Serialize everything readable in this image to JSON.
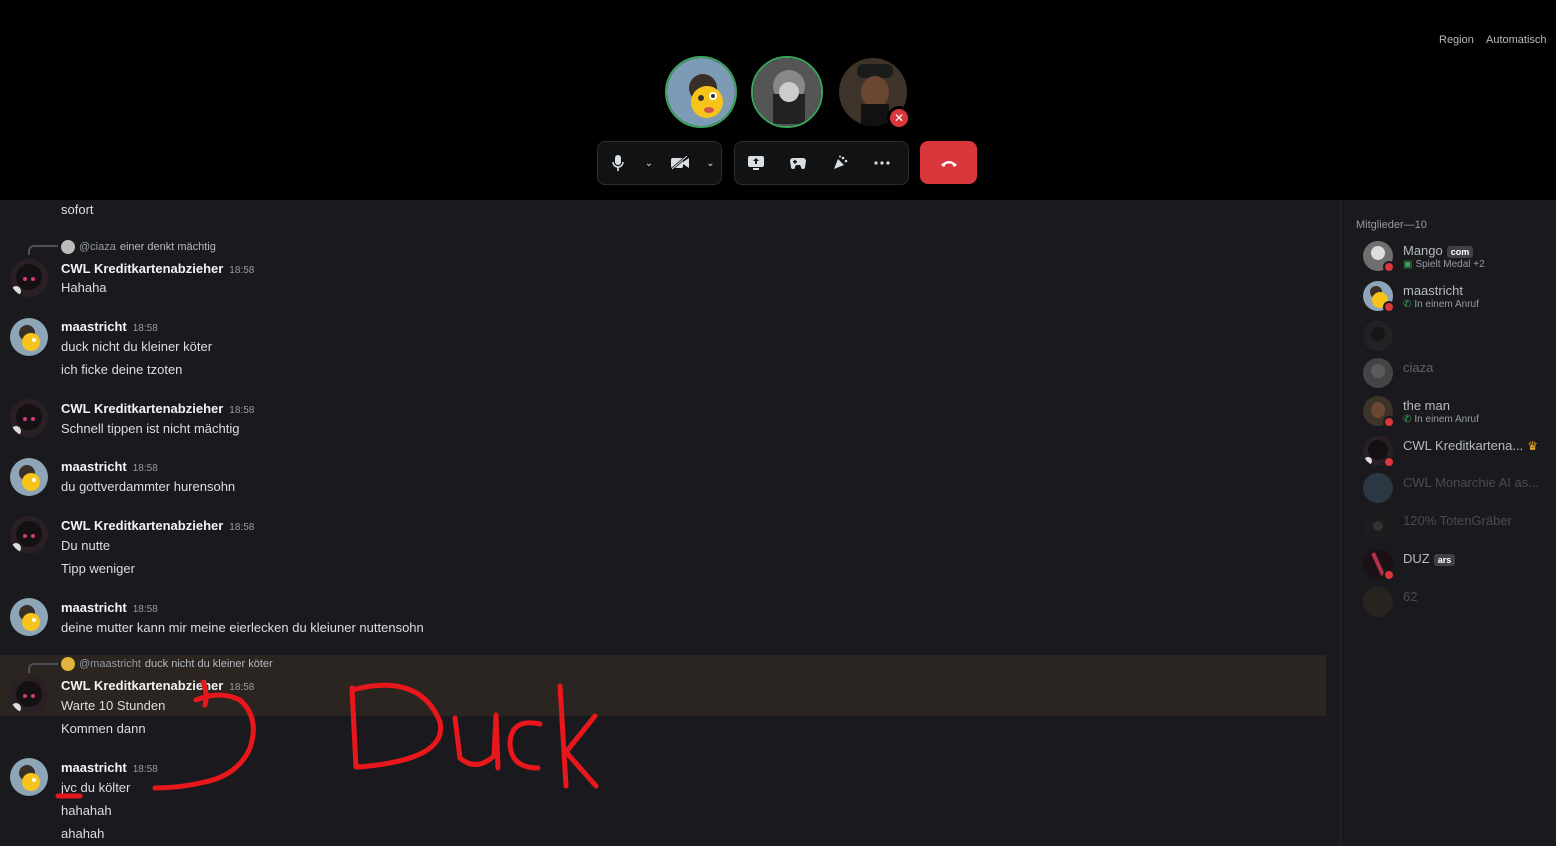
{
  "region": {
    "label": "Region",
    "value": "Automatisch"
  },
  "call": {
    "participants": [
      {
        "name": "maastricht",
        "speaking": true
      },
      {
        "name": "ciaza",
        "speaking": true
      },
      {
        "name": "the man",
        "speaking": false,
        "muted": true
      }
    ],
    "controls": [
      "mic-icon",
      "chevron-down-icon",
      "camera-off-icon",
      "chevron-down-icon",
      "screen-share-icon",
      "activity-icon",
      "soundboard-icon",
      "more-icon",
      "hang-up-icon"
    ]
  },
  "messages": [
    {
      "type": "continuation",
      "text": "sofort"
    },
    {
      "type": "reply",
      "reply_to": "@ciaza",
      "reply_text": "einer denkt mächtig",
      "author": "CWL Kreditkartenabzieher",
      "time": "18:58",
      "lines": [
        "Hahaha"
      ]
    },
    {
      "author": "maastricht",
      "time": "18:58",
      "lines": [
        "duck nicht du kleiner köter",
        "ich ficke deine tzoten"
      ]
    },
    {
      "author": "CWL Kreditkartenabzieher",
      "time": "18:58",
      "lines": [
        "Schnell tippen ist nicht mächtig"
      ]
    },
    {
      "author": "maastricht",
      "time": "18:58",
      "lines": [
        "du gottverdammter hurensohn"
      ]
    },
    {
      "author": "CWL Kreditkartenabzieher",
      "time": "18:58",
      "lines": [
        "Du nutte",
        "Tipp weniger"
      ]
    },
    {
      "author": "maastricht",
      "time": "18:58",
      "lines": [
        "deine mutter kann mir meine eierlecken du kleiuner nuttensohn"
      ]
    },
    {
      "type": "reply",
      "reply_to": "@maastricht",
      "reply_text": "duck nicht du kleiner köter",
      "author": "CWL Kreditkartenabzieher",
      "time": "18:58",
      "lines": [
        "Warte 10 Stunden",
        "Kommen dann"
      ]
    },
    {
      "author": "maastricht",
      "time": "18:58",
      "lines": [
        "jvc du költer",
        "hahahah",
        "ahahah"
      ]
    }
  ],
  "annotation": {
    "text": "Duck",
    "color": "#e8171c"
  },
  "members": {
    "header": "Mitglieder—10",
    "list": [
      {
        "name": "Mango",
        "tag": "com",
        "sub": "Spielt Medal +2",
        "sub_icon": "gamepad-icon"
      },
      {
        "name": "maastricht",
        "sub": "In einem Anruf",
        "sub_icon": "phone-icon"
      },
      {
        "name": ".",
        "dim": true
      },
      {
        "name": "ciaza",
        "dim": true
      },
      {
        "name": "the man",
        "sub": "In einem Anruf",
        "sub_icon": "phone-icon"
      },
      {
        "name": "CWL Kreditkartena...",
        "crown": true
      },
      {
        "name": "CWL Monarchie AI as...",
        "dim": true
      },
      {
        "name": "120% TotenGräber",
        "dim": true
      },
      {
        "name": "DUZ",
        "tag": "ars"
      },
      {
        "name": "62",
        "dim": true
      }
    ]
  }
}
